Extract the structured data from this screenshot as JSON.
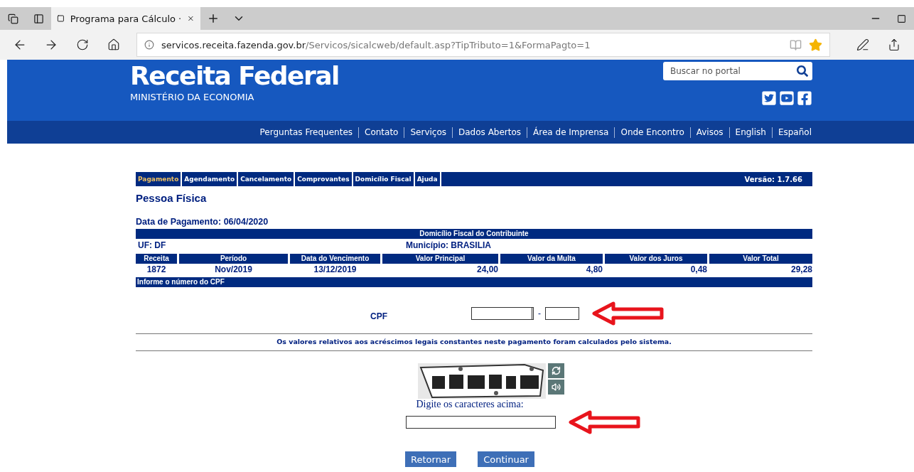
{
  "browser": {
    "tabs": [
      {
        "title": "Programa para Cálculo ·",
        "selected": true
      }
    ],
    "address": {
      "domain": "servicos.receita.fazenda.gov.br",
      "path": "/Servicos/sicalcweb/default.asp?TipTributo=1&FormaPagto=1"
    },
    "favorite": true
  },
  "header": {
    "title": "Receita Federal",
    "subtitle": "MINISTÉRIO DA ECONOMIA",
    "search": {
      "placeholder": "Buscar no portal"
    },
    "nav_links": [
      "Perguntas Frequentes",
      "Contato",
      "Serviços",
      "Dados Abertos",
      "Área de Imprensa",
      "Onde Encontro",
      "Avisos",
      "English",
      "Español"
    ]
  },
  "app_menu": {
    "items": [
      {
        "label": "Pagamento",
        "selected": true
      },
      {
        "label": "Agendamento",
        "selected": false
      },
      {
        "label": "Cancelamento",
        "selected": false
      },
      {
        "label": "Comprovantes",
        "selected": false
      },
      {
        "label": "Domicílio Fiscal",
        "selected": false
      },
      {
        "label": "Ajuda",
        "selected": false
      }
    ],
    "version": "Versão: 1.7.66"
  },
  "page_title": "Pessoa Física",
  "payment_date": "Data de Pagamento: 06/04/2020",
  "table": {
    "domicile_heading": "Domicílio Fiscal do Contribuinte",
    "uf": "UF: DF",
    "municipio": "Município: BRASILIA",
    "columns": [
      "Receita",
      "Período",
      "Data do Vencimento",
      "Valor Principal",
      "Valor da Multa",
      "Valor dos Juros",
      "Valor Total"
    ],
    "row": [
      "1872",
      "Nov/2019",
      "13/12/2019",
      "24,00",
      "4,80",
      "0,48",
      "29,28"
    ]
  },
  "cpf_bar": "Informe o número do CPF",
  "cpf": {
    "label": "CPF",
    "separator": "-"
  },
  "note": "Os valores relativos aos acréscimos legais constantes neste pagamento foram calculados pelo sistema.",
  "captcha": {
    "label": "Digite os caracteres acima:"
  },
  "buttons": [
    "Retornar",
    "Continuar"
  ]
}
